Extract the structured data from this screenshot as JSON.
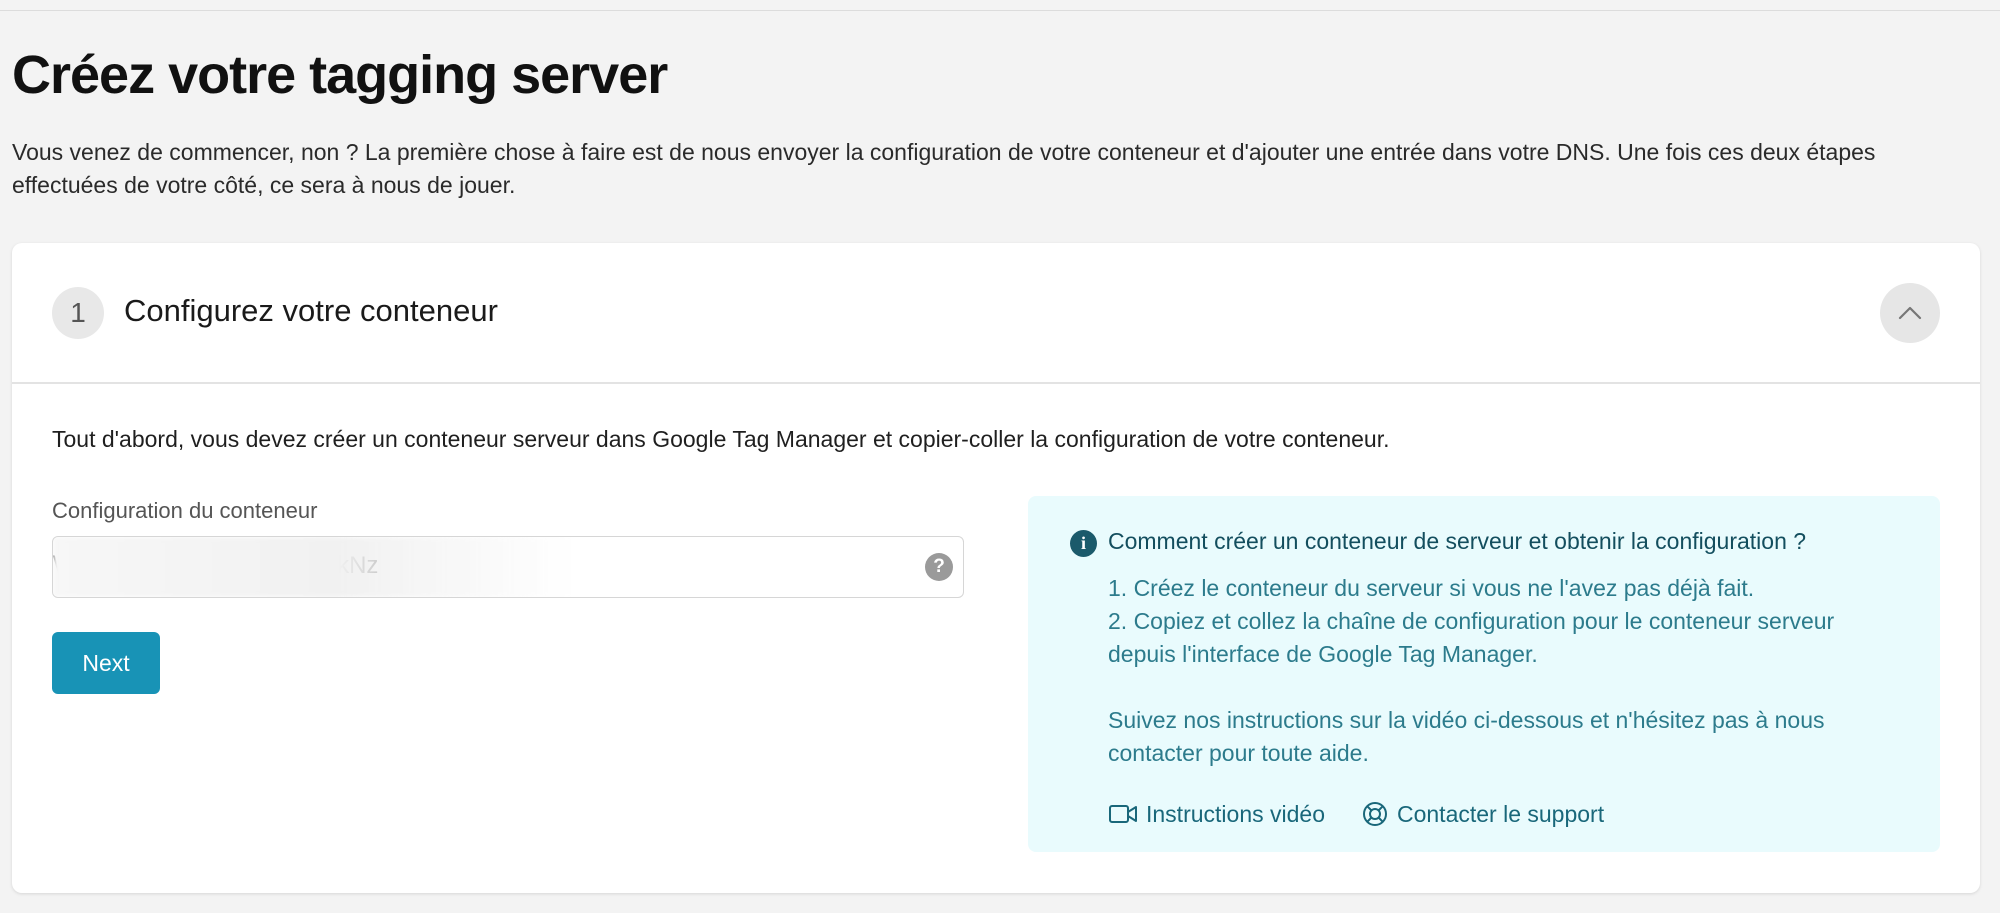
{
  "page": {
    "title": "Créez votre tagging server",
    "intro": "Vous venez de commencer, non ? La première chose à faire est de nous envoyer la configuration de votre conteneur et d'ajouter une entrée dans votre DNS. Une fois ces deux étapes effectuées de votre côté, ce sera à nous de jouer."
  },
  "step": {
    "number": "1",
    "title": "Configurez votre conteneur",
    "collapse_icon": "chevron-up-icon",
    "description": "Tout d'abord, vous devez créer un conteneur serveur dans Google Tag Manager et copier-coller la configuration de votre conteneur."
  },
  "form": {
    "label": "Configuration du conteneur",
    "value": "D1ZazNWbmlUY2pkejdrSkNz\\",
    "help_icon": "question-circle-icon",
    "next_label": "Next"
  },
  "info": {
    "icon": "info-icon",
    "title": "Comment créer un conteneur de serveur et obtenir la configuration ?",
    "lines": [
      "1. Créez le conteneur du serveur si vous ne l'avez pas déjà fait.",
      "2. Copiez et collez la chaîne de configuration pour le conteneur serveur depuis l'interface de Google Tag Manager.",
      "",
      "Suivez nos instructions sur la vidéo ci-dessous et n'hésitez pas à nous contacter pour toute aide."
    ],
    "links": [
      {
        "label": "Instructions vidéo",
        "icon": "video-camera-icon"
      },
      {
        "label": "Contacter le support",
        "icon": "lifebuoy-icon"
      }
    ],
    "colors": {
      "panel_bg": "#e9fbfd",
      "text": "#2c7b8c",
      "title": "#134e5e"
    }
  },
  "colors": {
    "accent": "#1893b6",
    "page_bg": "#f3f3f3"
  }
}
